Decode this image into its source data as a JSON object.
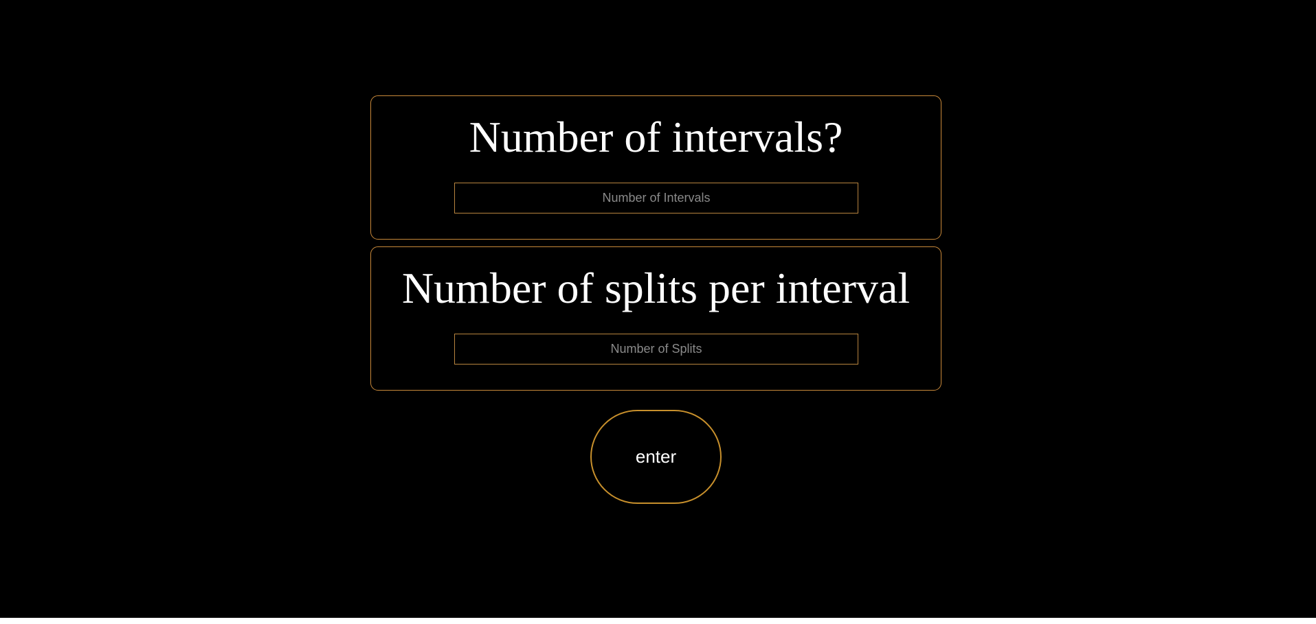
{
  "intervals": {
    "title": "Number of intervals?",
    "input_value": "",
    "input_placeholder": "Number of Intervals"
  },
  "splits": {
    "title": "Number of splits per interval",
    "input_value": "",
    "input_placeholder": "Number of Splits"
  },
  "enter_button": {
    "label": "enter"
  },
  "colors": {
    "background": "#000000",
    "accent_border": "#c9893a",
    "text": "#ffffff",
    "placeholder": "#8a8a8a"
  }
}
